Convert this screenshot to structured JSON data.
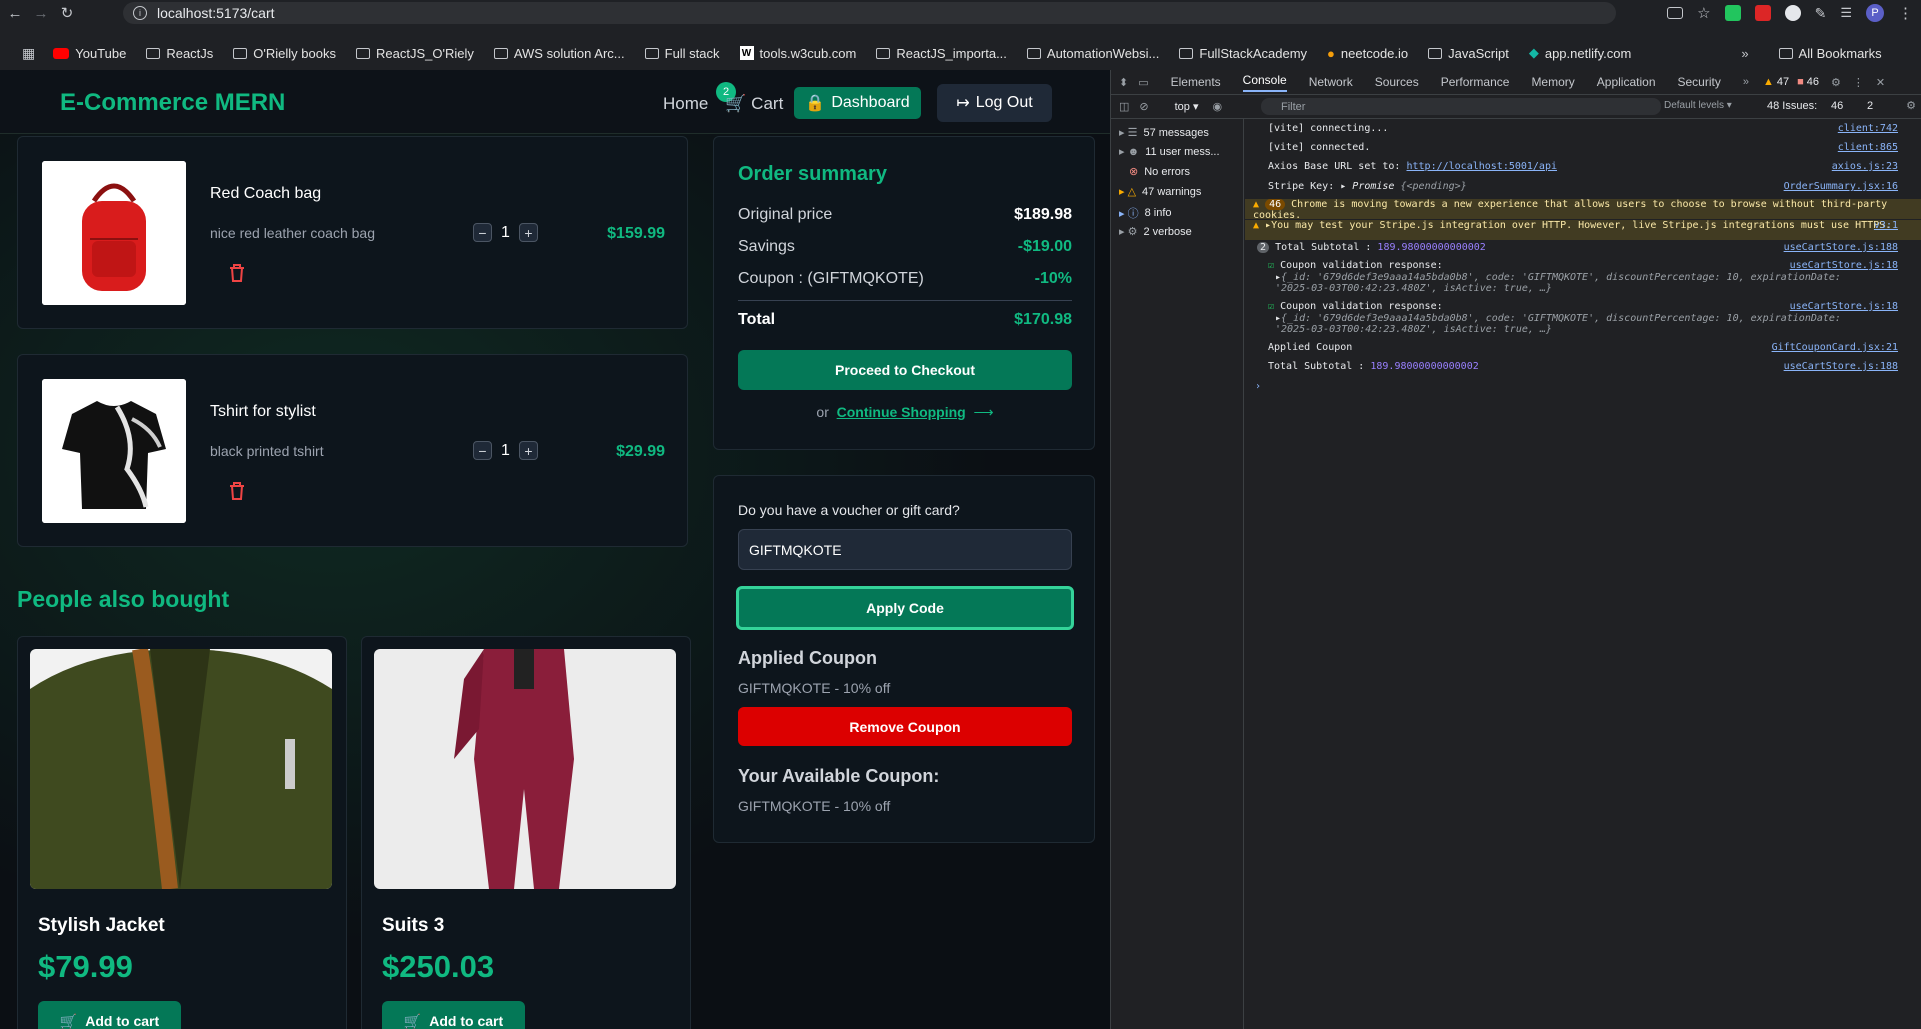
{
  "browser": {
    "url": "localhost:5173/cart",
    "bookmarks": [
      "YouTube",
      "ReactJs",
      "O'Rielly books",
      "ReactJS_O'Riely",
      "AWS solution Arc...",
      "Full stack",
      "tools.w3cub.com",
      "ReactJS_importa...",
      "AutomationWebsi...",
      "FullStackAcademy",
      "neetcode.io",
      "JavaScript",
      "app.netlify.com"
    ],
    "all_bookmarks": "All Bookmarks",
    "profile_initial": "P"
  },
  "header": {
    "brand": "E-Commerce MERN",
    "home": "Home",
    "cart": "Cart",
    "cart_count": "2",
    "dashboard": "Dashboard",
    "logout": "Log Out"
  },
  "cart_items": [
    {
      "name": "Red Coach bag",
      "description": "nice red leather coach bag",
      "quantity": "1",
      "price": "$159.99"
    },
    {
      "name": "Tshirt for stylist",
      "description": "black printed tshirt",
      "quantity": "1",
      "price": "$29.99"
    }
  ],
  "summary": {
    "title": "Order summary",
    "original_label": "Original price",
    "original_value": "$189.98",
    "savings_label": "Savings",
    "savings_value": "-$19.00",
    "coupon_label": "Coupon : (GIFTMQKOTE)",
    "coupon_value": "-10%",
    "total_label": "Total",
    "total_value": "$170.98",
    "checkout": "Proceed to Checkout",
    "or": "or",
    "continue": "Continue Shopping"
  },
  "voucher": {
    "label": "Do you have a voucher or gift card?",
    "input_value": "GIFTMQKOTE",
    "apply": "Apply Code",
    "applied_title": "Applied Coupon",
    "applied_value": "GIFTMQKOTE - 10% off",
    "remove": "Remove Coupon",
    "available_title": "Your Available Coupon:",
    "available_value": "GIFTMQKOTE - 10% off"
  },
  "recommendations": {
    "title": "People also bought",
    "items": [
      {
        "name": "Stylish Jacket",
        "price": "$79.99",
        "button": "Add to cart"
      },
      {
        "name": "Suits 3",
        "price": "$250.03",
        "button": "Add to cart"
      }
    ]
  },
  "devtools": {
    "tabs": [
      "Elements",
      "Console",
      "Network",
      "Sources",
      "Performance",
      "Memory",
      "Application",
      "Security"
    ],
    "warnings_count": "47",
    "errors_count": "46",
    "context": "top",
    "filter_placeholder": "Filter",
    "levels": "Default levels",
    "issues_label": "48 Issues:",
    "issues_errors": "46",
    "issues_info": "2",
    "sidebar": [
      "57 messages",
      "11 user mess...",
      "No errors",
      "47 warnings",
      "8 info",
      "2 verbose"
    ],
    "logs": {
      "l1": "[vite] connecting...",
      "l1_src": "client:742",
      "l2": "[vite] connected.",
      "l2_src": "client:865",
      "l3": "Axios Base URL set to:",
      "l3_link": "http://localhost:5001/api",
      "l3_src": "axios.js:23",
      "l4": "Stripe Key:",
      "l4_promise": "Promise",
      "l4_pending": "{<pending>}",
      "l4_src": "OrderSummary.jsx:16",
      "l5_count": "46",
      "l5": "Chrome is moving towards a new experience that allows users to choose to browse without third-party cookies.",
      "l6": "You may test your Stripe.js integration over HTTP. However, live Stripe.js integrations must use HTTPS.",
      "l6_src": "v3:1",
      "l7_count": "2",
      "l7": "Total Subtotal :",
      "l7_val": "189.98000000000002",
      "l7_src": "useCartStore.js:188",
      "l8": "Coupon validation response:",
      "l8_src": "useCartStore.js:18",
      "l8_obj": "{_id: '679d6def3e9aaa14a5bda0b8', code: 'GIFTMQKOTE', discountPercentage: 10, expirationDate: '2025-03-03T00:42:23.480Z', isActive: true, …}",
      "l9": "Coupon validation response:",
      "l9_src": "useCartStore.js:18",
      "l10": "Applied Coupon",
      "l10_src": "GiftCouponCard.jsx:21",
      "l11": "Total Subtotal :",
      "l11_val": "189.98000000000002",
      "l11_src": "useCartStore.js:188"
    }
  }
}
